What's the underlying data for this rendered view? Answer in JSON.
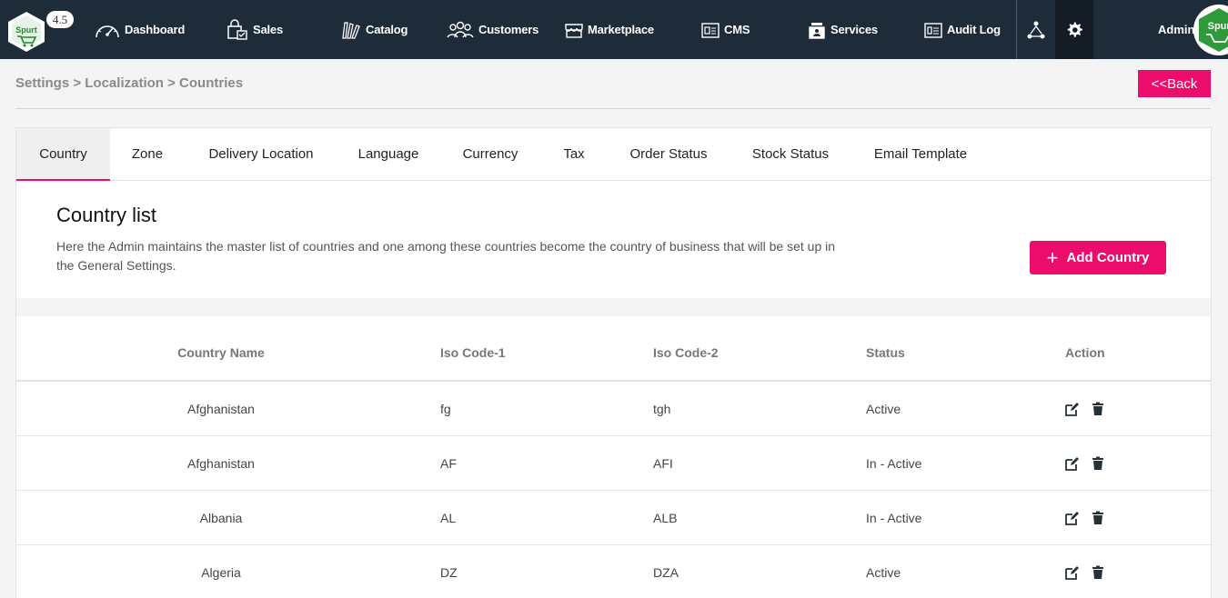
{
  "app": {
    "logo_text": "Spurt",
    "version": "4.5",
    "admin_label": "Admin",
    "accent": "#ec0c6c",
    "nav_bg": "#1e2b38"
  },
  "nav": [
    {
      "label": "Dashboard",
      "icon": "dashboard-icon"
    },
    {
      "label": "Sales",
      "icon": "sales-icon"
    },
    {
      "label": "Catalog",
      "icon": "catalog-icon"
    },
    {
      "label": "Customers",
      "icon": "customers-icon"
    },
    {
      "label": "Marketplace",
      "icon": "marketplace-icon"
    },
    {
      "label": "CMS",
      "icon": "cms-icon"
    },
    {
      "label": "Services",
      "icon": "services-icon"
    },
    {
      "label": "Audit Log",
      "icon": "audit-log-icon"
    }
  ],
  "breadcrumb": "Settings > Localization > Countries",
  "back_label": "<<Back",
  "tabs": [
    "Country",
    "Zone",
    "Delivery Location",
    "Language",
    "Currency",
    "Tax",
    "Order Status",
    "Stock Status",
    "Email Template"
  ],
  "active_tab": "Country",
  "list": {
    "title": "Country list",
    "description": "Here the Admin maintains the master list of countries and one among these countries become the country of business that will be set up in the General Settings.",
    "add_label": "Add Country"
  },
  "table": {
    "headers": {
      "name": "Country Name",
      "iso1": "Iso Code-1",
      "iso2": "Iso Code-2",
      "status": "Status",
      "action": "Action"
    },
    "rows": [
      {
        "name": "Afghanistan",
        "iso1": "fg",
        "iso2": "tgh",
        "status": "Active"
      },
      {
        "name": "Afghanistan",
        "iso1": "AF",
        "iso2": "AFI",
        "status": "In - Active"
      },
      {
        "name": "Albania",
        "iso1": "AL",
        "iso2": "ALB",
        "status": "In - Active"
      },
      {
        "name": "Algeria",
        "iso1": "DZ",
        "iso2": "DZA",
        "status": "Active"
      }
    ]
  }
}
